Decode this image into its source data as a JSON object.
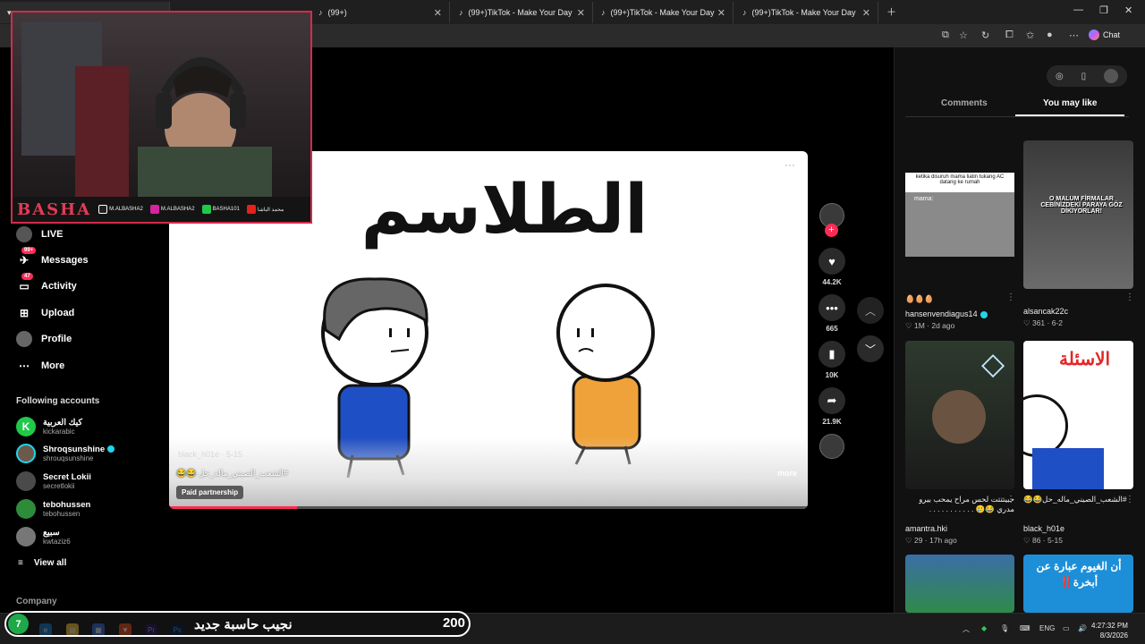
{
  "browser": {
    "tabs": [
      {
        "label": "(99+)"
      },
      {
        "label": "(99+)TikTok - Make Your Day"
      },
      {
        "label": "(99+)TikTok - Make Your Day"
      },
      {
        "label": "(99+)TikTok - Make Your Day"
      }
    ],
    "copilot_label": "Chat"
  },
  "webcam": {
    "brand": "BASHA",
    "socials": [
      "M.ALBASHA2",
      "M.ALBASHA2",
      "BASHA101",
      "محمد الباشا"
    ]
  },
  "sidebar": {
    "nav": [
      {
        "label": "LIVE",
        "icon": "live-icon"
      },
      {
        "label": "Messages",
        "icon": "messages-icon",
        "badge": "99+"
      },
      {
        "label": "Activity",
        "icon": "activity-icon",
        "badge": "47"
      },
      {
        "label": "Upload",
        "icon": "upload-icon"
      },
      {
        "label": "Profile",
        "icon": "profile-icon"
      },
      {
        "label": "More",
        "icon": "more-icon"
      }
    ],
    "following_title": "Following accounts",
    "following": [
      {
        "name": "كيك العربية",
        "handle": "kickarabic",
        "color": "#20c94a"
      },
      {
        "name": "Shroqsunshine",
        "handle": "shrouqsunshine",
        "color": "#6b5a4a",
        "verified": true
      },
      {
        "name": "Secret Lokii",
        "handle": "secretlokii",
        "color": "#4a4a4a"
      },
      {
        "name": "tebohussen",
        "handle": "tebohussen",
        "color": "#2e8b3a"
      },
      {
        "name": "سبيع",
        "handle": "kwtaziz6",
        "color": "#777"
      }
    ],
    "view_all": "View all",
    "company": "Company"
  },
  "video": {
    "title_art": "الطلاسم",
    "author": "black_h01e · 5-15",
    "caption": "#الشعب_الصيني_ماله_حل 😂😂",
    "more": "more",
    "paid": "Paid partnership",
    "progress": 0.2,
    "options": "···"
  },
  "actions": {
    "likes": "44.2K",
    "comments": "665",
    "saves": "10K",
    "shares": "21.9K"
  },
  "right_panel": {
    "tab_comments": "Comments",
    "tab_you_may_like": "You may like",
    "thumbs": [
      {
        "caption": "🥚🥚🥚",
        "author": "hansenvendiagus14",
        "verified": true,
        "meta": "♡ 1M · 2d ago",
        "overlay": "ketika disuruh mama liatin tukang AC datang ke rumah",
        "overlay2": "mama:"
      },
      {
        "caption": "",
        "author": "alsancak22c",
        "meta": "♡ 361 · 6-2",
        "overlay": "O MALUM FİRMALAR CEBİNİZDEKİ PARAYA GÖZ DİKİYORLAR!"
      },
      {
        "caption": "حبيتتتت لحس مراح يمحب بيرو مدري 😂🥲 . . . . . . . . . . .",
        "author": "amantra.hki",
        "meta": "♡ 29 · 17h ago"
      },
      {
        "caption": "#الشعب_الصيني_ماله_حل😂😂",
        "author": "black_h01e",
        "meta": "♡ 86 · 5-15",
        "overlay": "الاسئلة"
      },
      {
        "overlay": "أن الغيوم عبارة عن أبخرة‼️"
      }
    ]
  },
  "stream_bar": {
    "circle": "7",
    "text": "نجيب حاسبة جديد",
    "number": "200"
  },
  "taskbar": {
    "lang": "ENG",
    "time": "4:27:32 PM",
    "date": "8/3/2026"
  }
}
